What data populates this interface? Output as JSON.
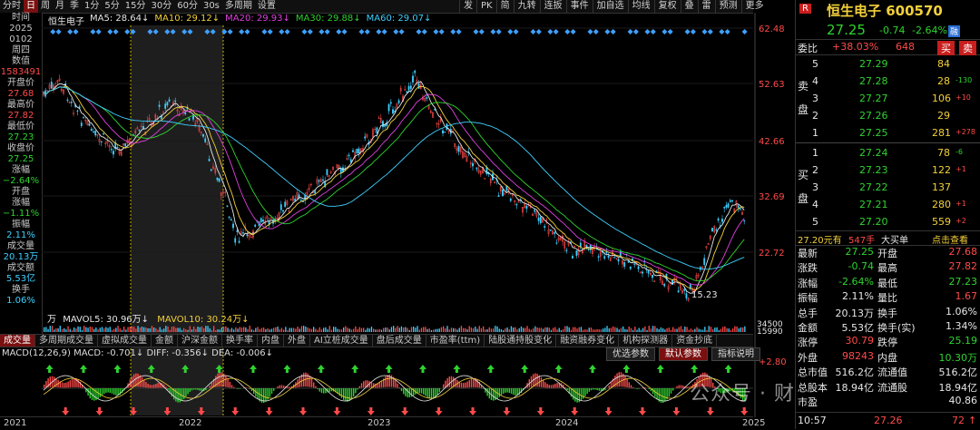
{
  "toolbar": {
    "left_items": [
      "分时",
      "日",
      "周",
      "月",
      "季",
      "1分",
      "5分",
      "15分",
      "30分",
      "60分",
      "30s",
      "多周期",
      "设置"
    ],
    "active_index": 1,
    "right_items": [
      "发",
      "PK",
      "简",
      "九转",
      "连扳",
      "事件",
      "加自选",
      "均线",
      "复权",
      "叠",
      "雷",
      "预测",
      "更多"
    ]
  },
  "left_panel": [
    {
      "t": "时间",
      "c": "lbl"
    },
    {
      "t": "2025",
      "c": "lbl"
    },
    {
      "t": "0102",
      "c": "lbl"
    },
    {
      "t": "周四",
      "c": "lbl"
    },
    {
      "t": "数值",
      "c": "lbl"
    },
    {
      "t": "1583491",
      "c": "red"
    },
    {
      "t": "开盘价",
      "c": "lbl"
    },
    {
      "t": "27.68",
      "c": "red"
    },
    {
      "t": "最高价",
      "c": "lbl"
    },
    {
      "t": "27.82",
      "c": "red"
    },
    {
      "t": "最低价",
      "c": "lbl"
    },
    {
      "t": "27.23",
      "c": "grn"
    },
    {
      "t": "收盘价",
      "c": "lbl"
    },
    {
      "t": "27.25",
      "c": "grn"
    },
    {
      "t": "涨幅",
      "c": "lbl"
    },
    {
      "t": "−2.64%",
      "c": "grn"
    },
    {
      "t": "开盘",
      "c": "lbl"
    },
    {
      "t": "涨幅",
      "c": "lbl"
    },
    {
      "t": "−1.11%",
      "c": "grn"
    },
    {
      "t": "振幅",
      "c": "lbl"
    },
    {
      "t": "2.11%",
      "c": "cyan"
    },
    {
      "t": "成交量",
      "c": "lbl"
    },
    {
      "t": "20.13万",
      "c": "cyan"
    },
    {
      "t": "成交额",
      "c": "lbl"
    },
    {
      "t": "5.53亿",
      "c": "cyan"
    },
    {
      "t": "换手",
      "c": "lbl"
    },
    {
      "t": "1.06%",
      "c": "cyan"
    }
  ],
  "ma_legend": {
    "name": "恒生电子",
    "items": [
      {
        "label": "MA5: 28.64↓",
        "color": "#e6e6e6"
      },
      {
        "label": "MA10: 29.12↓",
        "color": "#f3d03a"
      },
      {
        "label": "MA20: 29.93↓",
        "color": "#e040e0"
      },
      {
        "label": "MA30: 29.88↓",
        "color": "#2fd32f"
      },
      {
        "label": "MA60: 29.07↓",
        "color": "#3fd0ff"
      }
    ]
  },
  "price_axis": [
    "62.48",
    "52.63",
    "42.66",
    "32.69",
    "22.72"
  ],
  "chart_annotations": {
    "low_label": "15.23",
    "vol_axis": [
      "34500",
      "15990"
    ]
  },
  "volume_legend": {
    "unit": "万",
    "mavol5": "MAVOL5: 30.96万↓",
    "mavol10": "MAVOL10: 30.24万↓"
  },
  "tabs": [
    "成交量",
    "多周期成交量",
    "虚拟成交量",
    "金额",
    "沪深金额",
    "换手率",
    "内盘",
    "外盘",
    "AI立桩成交量",
    "盘后成交量",
    "市盈率(ttm)",
    "陆股通持股变化",
    "融资融券变化",
    "机构探测器",
    "资金抄底"
  ],
  "tabs_active": 0,
  "sub_buttons": [
    "优选参数",
    "默认参数",
    "指标说明"
  ],
  "sub_active": 1,
  "macd_legend": "MACD(12,26,9)   MACD: -0.701↓   DIFF: -0.356↓   DEA: -0.006↓",
  "macd_axis": "+2.80",
  "x_axis": [
    "2021",
    "2022",
    "2023",
    "2024",
    "2025"
  ],
  "watermark": "公众号 · 财富讲解",
  "quote": {
    "badge": "R",
    "name": "恒生电子 600570",
    "price": "27.25",
    "change": "-0.74",
    "pct": "-2.64%",
    "tag": "融",
    "weibi_label": "委比",
    "weibi": "+38.03%",
    "weicha": "648",
    "sell_btn": "买",
    "buy_btn": "卖",
    "asks": [
      {
        "lvl": "5",
        "p": "27.29",
        "v": "84",
        "d": ""
      },
      {
        "lvl": "4",
        "p": "27.28",
        "v": "28",
        "d": "-130"
      },
      {
        "lvl": "3",
        "p": "27.27",
        "v": "106",
        "d": "+10"
      },
      {
        "lvl": "2",
        "p": "27.26",
        "v": "29",
        "d": ""
      },
      {
        "lvl": "1",
        "p": "27.25",
        "v": "281",
        "d": "+278"
      }
    ],
    "ask_label": "卖盘",
    "bids": [
      {
        "lvl": "1",
        "p": "27.24",
        "v": "78",
        "d": "-6"
      },
      {
        "lvl": "2",
        "p": "27.23",
        "v": "122",
        "d": "+1"
      },
      {
        "lvl": "3",
        "p": "27.22",
        "v": "137",
        "d": ""
      },
      {
        "lvl": "4",
        "p": "27.21",
        "v": "280",
        "d": "+1"
      },
      {
        "lvl": "5",
        "p": "27.20",
        "v": "559",
        "d": "+2"
      }
    ],
    "bid_label": "买盘",
    "bigorder": {
      "price": "27.20元有",
      "vol": "547手",
      "tag": "大买单",
      "link": "点击查看"
    },
    "stats": [
      {
        "k1": "最新",
        "v1": "27.25",
        "c1": "grn",
        "k2": "开盘",
        "v2": "27.68",
        "c2": "red"
      },
      {
        "k1": "涨跌",
        "v1": "-0.74",
        "c1": "grn",
        "k2": "最高",
        "v2": "27.82",
        "c2": "red"
      },
      {
        "k1": "涨幅",
        "v1": "-2.64%",
        "c1": "grn",
        "k2": "最低",
        "v2": "27.23",
        "c2": "grn"
      },
      {
        "k1": "振幅",
        "v1": "2.11%",
        "c1": "wht",
        "k2": "量比",
        "v2": "1.67",
        "c2": "red"
      },
      {
        "k1": "总手",
        "v1": "20.13万",
        "c1": "wht",
        "k2": "换手",
        "v2": "1.06%",
        "c2": "wht"
      },
      {
        "k1": "金额",
        "v1": "5.53亿",
        "c1": "wht",
        "k2": "换手(实)",
        "v2": "1.34%",
        "c2": "wht"
      },
      {
        "k1": "涨停",
        "v1": "30.79",
        "c1": "red",
        "k2": "跌停",
        "v2": "25.19",
        "c2": "grn"
      },
      {
        "k1": "外盘",
        "v1": "98243",
        "c1": "red",
        "k2": "内盘",
        "v2": "10.30万",
        "c2": "grn"
      },
      {
        "k1": "总市值",
        "v1": "516.2亿",
        "c1": "wht",
        "k2": "流通值",
        "v2": "516.2亿",
        "c2": "wht"
      },
      {
        "k1": "总股本",
        "v1": "18.94亿",
        "c1": "wht",
        "k2": "流通股",
        "v2": "18.94亿",
        "c2": "wht"
      },
      {
        "k1": "市盈",
        "v1": "",
        "c1": "wht",
        "k2": "",
        "v2": "40.86",
        "c2": "wht"
      }
    ],
    "last_tick": {
      "time": "10:57",
      "price": "27.26",
      "vol": "72",
      "arrow": "↑"
    }
  }
}
